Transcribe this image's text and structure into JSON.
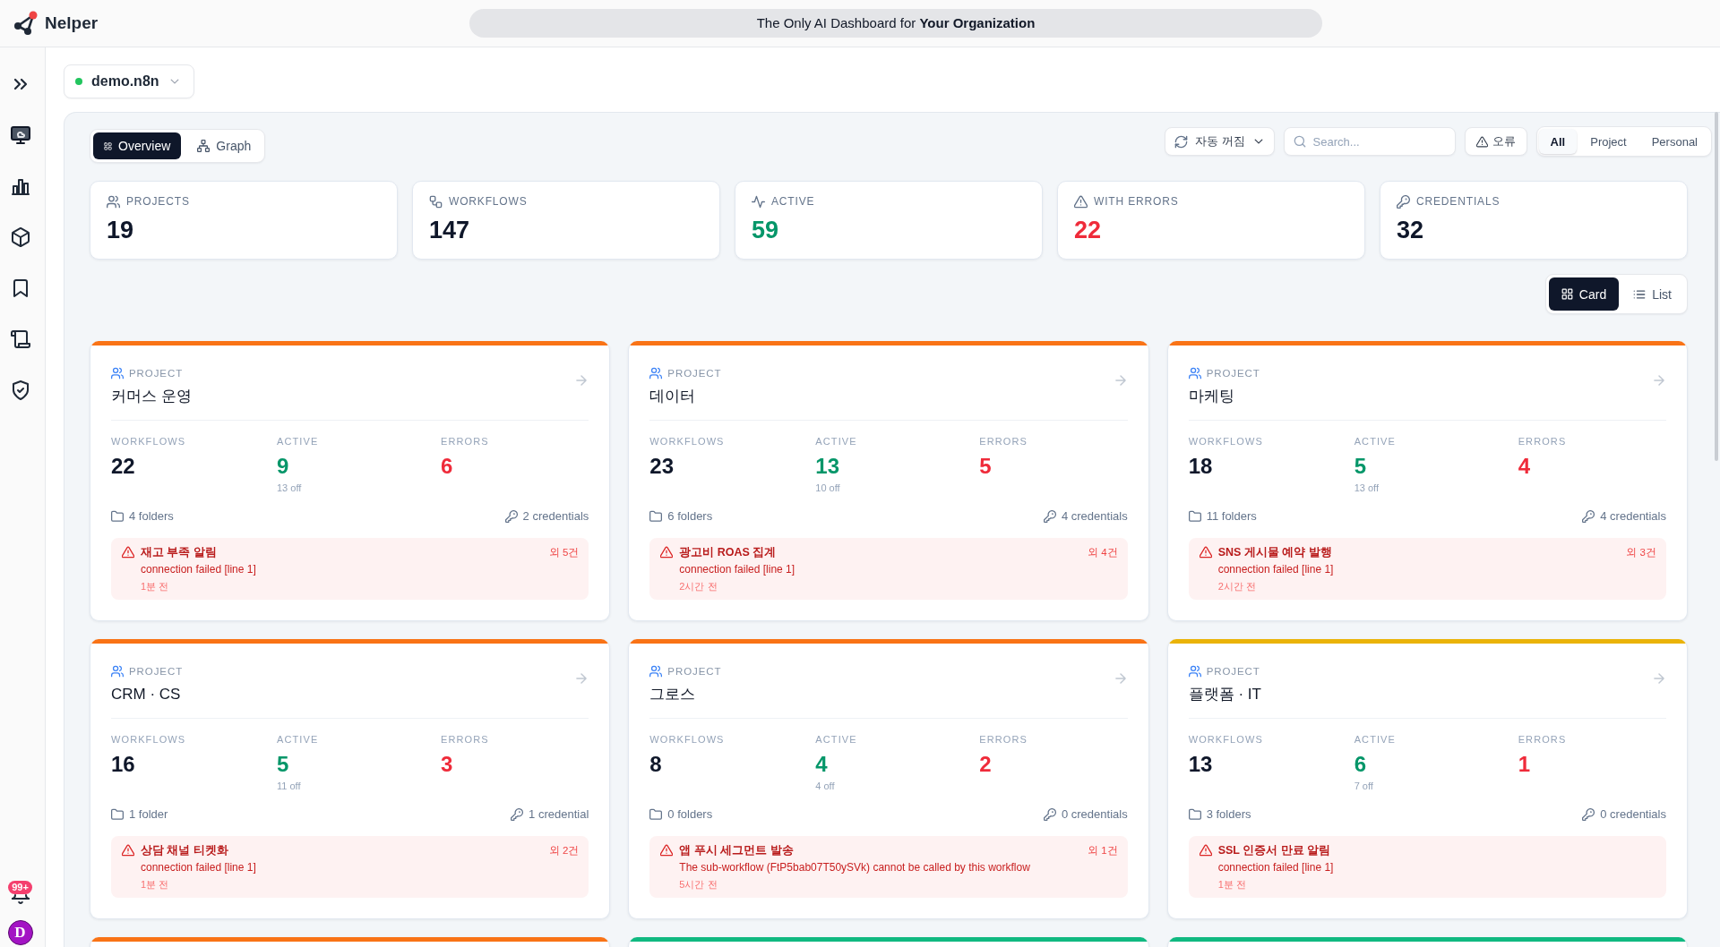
{
  "header": {
    "app_name": "Nelper",
    "banner": "The Only AI Dashboard for **Your Organization**"
  },
  "sidebar": {
    "items": [
      {
        "selected": true
      },
      {
        "selected": false
      },
      {
        "selected": false
      },
      {
        "selected": false
      },
      {
        "selected": false
      },
      {
        "selected": false
      }
    ],
    "notifications": {
      "badge": "99+"
    },
    "avatar": {
      "initial": "D"
    }
  },
  "workspace": {
    "name": "demo.n8n",
    "online": true
  },
  "view_tabs": [
    {
      "label": "Overview",
      "selected": true
    },
    {
      "label": "Graph",
      "selected": false
    }
  ],
  "toolbar": {
    "refresh": {
      "label": "자동 꺼짐"
    },
    "search": {
      "placeholder": "Search..."
    },
    "error_filter": {
      "label": "오류"
    },
    "scope_tabs": [
      {
        "label": "All",
        "selected": true
      },
      {
        "label": "Project",
        "selected": false
      },
      {
        "label": "Personal",
        "selected": false
      }
    ]
  },
  "stats": [
    {
      "kind": "projects",
      "label": "PROJECTS",
      "value": "19"
    },
    {
      "kind": "workflows",
      "label": "WORKFLOWS",
      "value": "147"
    },
    {
      "kind": "active",
      "label": "ACTIVE",
      "value": "59"
    },
    {
      "kind": "errors",
      "label": "WITH ERRORS",
      "value": "22"
    },
    {
      "kind": "credentials",
      "label": "CREDENTIALS",
      "value": "32"
    }
  ],
  "layout_tabs": [
    {
      "label": "Card",
      "selected": true
    },
    {
      "label": "List",
      "selected": false
    }
  ],
  "projects": [
    {
      "color": "#f97316",
      "label": "PROJECT",
      "name": "커머스 운영",
      "metrics": [
        {
          "kind": "total",
          "label": "WORKFLOWS",
          "value": "22"
        },
        {
          "kind": "active",
          "label": "ACTIVE",
          "value": "9",
          "note": "13 off"
        },
        {
          "kind": "errors",
          "label": "ERRORS",
          "value": "6"
        }
      ],
      "folders": "4 folders",
      "credentials": "2 credentials",
      "latest_error": {
        "workflow": "재고 부족 알림",
        "message": "connection failed [line 1]",
        "time": "1분 전",
        "more": "외 5건"
      }
    },
    {
      "color": "#f97316",
      "label": "PROJECT",
      "name": "데이터",
      "metrics": [
        {
          "kind": "total",
          "label": "WORKFLOWS",
          "value": "23"
        },
        {
          "kind": "active",
          "label": "ACTIVE",
          "value": "13",
          "note": "10 off"
        },
        {
          "kind": "errors",
          "label": "ERRORS",
          "value": "5"
        }
      ],
      "folders": "6 folders",
      "credentials": "4 credentials",
      "latest_error": {
        "workflow": "광고비 ROAS 집계",
        "message": "connection failed [line 1]",
        "time": "2시간 전",
        "more": "외 4건"
      }
    },
    {
      "color": "#f97316",
      "label": "PROJECT",
      "name": "마케팅",
      "metrics": [
        {
          "kind": "total",
          "label": "WORKFLOWS",
          "value": "18"
        },
        {
          "kind": "active",
          "label": "ACTIVE",
          "value": "5",
          "note": "13 off"
        },
        {
          "kind": "errors",
          "label": "ERRORS",
          "value": "4"
        }
      ],
      "folders": "11 folders",
      "credentials": "4 credentials",
      "latest_error": {
        "workflow": "SNS 게시물 예약 발행",
        "message": "connection failed [line 1]",
        "time": "2시간 전",
        "more": "외 3건"
      }
    },
    {
      "color": "#f97316",
      "label": "PROJECT",
      "name": "CRM · CS",
      "metrics": [
        {
          "kind": "total",
          "label": "WORKFLOWS",
          "value": "16"
        },
        {
          "kind": "active",
          "label": "ACTIVE",
          "value": "5",
          "note": "11 off"
        },
        {
          "kind": "errors",
          "label": "ERRORS",
          "value": "3"
        }
      ],
      "folders": "1 folder",
      "credentials": "1 credential",
      "latest_error": {
        "workflow": "상담 채널 티켓화",
        "message": "connection failed [line 1]",
        "time": "1분 전",
        "more": "외 2건"
      }
    },
    {
      "color": "#f97316",
      "label": "PROJECT",
      "name": "그로스",
      "metrics": [
        {
          "kind": "total",
          "label": "WORKFLOWS",
          "value": "8"
        },
        {
          "kind": "active",
          "label": "ACTIVE",
          "value": "4",
          "note": "4 off"
        },
        {
          "kind": "errors",
          "label": "ERRORS",
          "value": "2"
        }
      ],
      "folders": "0 folders",
      "credentials": "0 credentials",
      "latest_error": {
        "workflow": "앱 푸시 세그먼트 발송",
        "message": "The sub-workflow (FtP5bab07T50ySVk) cannot be called by this workflow",
        "time": "5시간 전",
        "more": "외 1건"
      }
    },
    {
      "color": "#eab308",
      "label": "PROJECT",
      "name": "플랫폼 · IT",
      "metrics": [
        {
          "kind": "total",
          "label": "WORKFLOWS",
          "value": "13"
        },
        {
          "kind": "active",
          "label": "ACTIVE",
          "value": "6",
          "note": "7 off"
        },
        {
          "kind": "errors",
          "label": "ERRORS",
          "value": "1"
        }
      ],
      "folders": "3 folders",
      "credentials": "0 credentials",
      "latest_error": {
        "workflow": "SSL 인증서 만료 알림",
        "message": "connection failed [line 1]",
        "time": "1분 전"
      }
    },
    {
      "color": "#f97316"
    },
    {
      "color": "#10b981"
    },
    {
      "color": "#10b981"
    }
  ]
}
